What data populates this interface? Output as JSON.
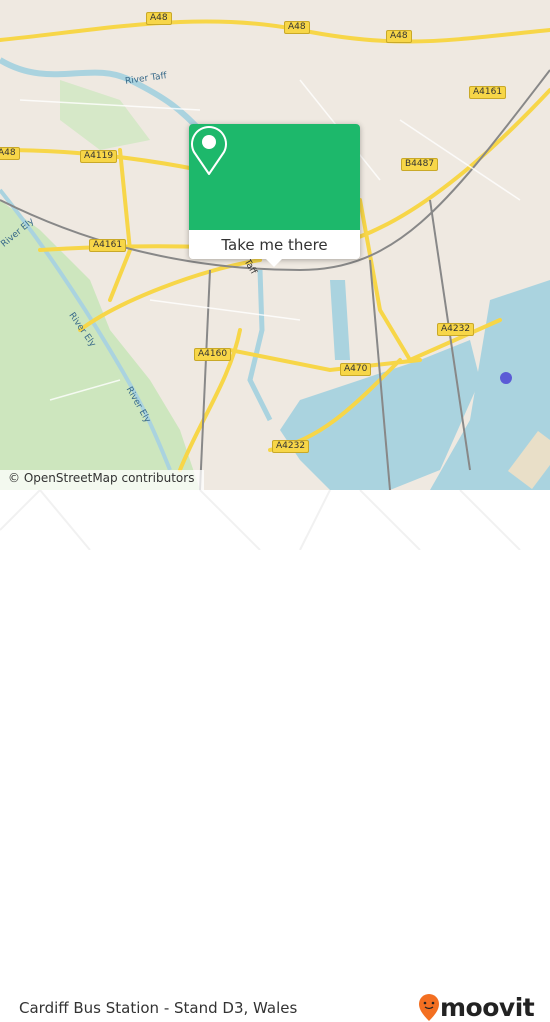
{
  "map": {
    "road_labels": [
      "A48",
      "A48",
      "A48",
      "A4161",
      "B4487",
      "A4119",
      "A4161",
      "A48",
      "A4232",
      "A470",
      "A4160",
      "A4232"
    ],
    "river_labels": [
      "River Taff",
      "River Ely",
      "River Ely",
      "River Ely",
      "Taff"
    ],
    "attribution": "© OpenStreetMap contributors",
    "colors": {
      "land": "#efe9e1",
      "water": "#aad3df",
      "park": "#cde6be",
      "road": "#f7d648"
    }
  },
  "popup": {
    "icon": "map-pin-icon",
    "button_label": "Take me there",
    "color": "#1db86b"
  },
  "footer": {
    "title": "Cardiff Bus Station - Stand D3, Wales",
    "brand": "moovit",
    "brand_color": "#f36f21"
  }
}
